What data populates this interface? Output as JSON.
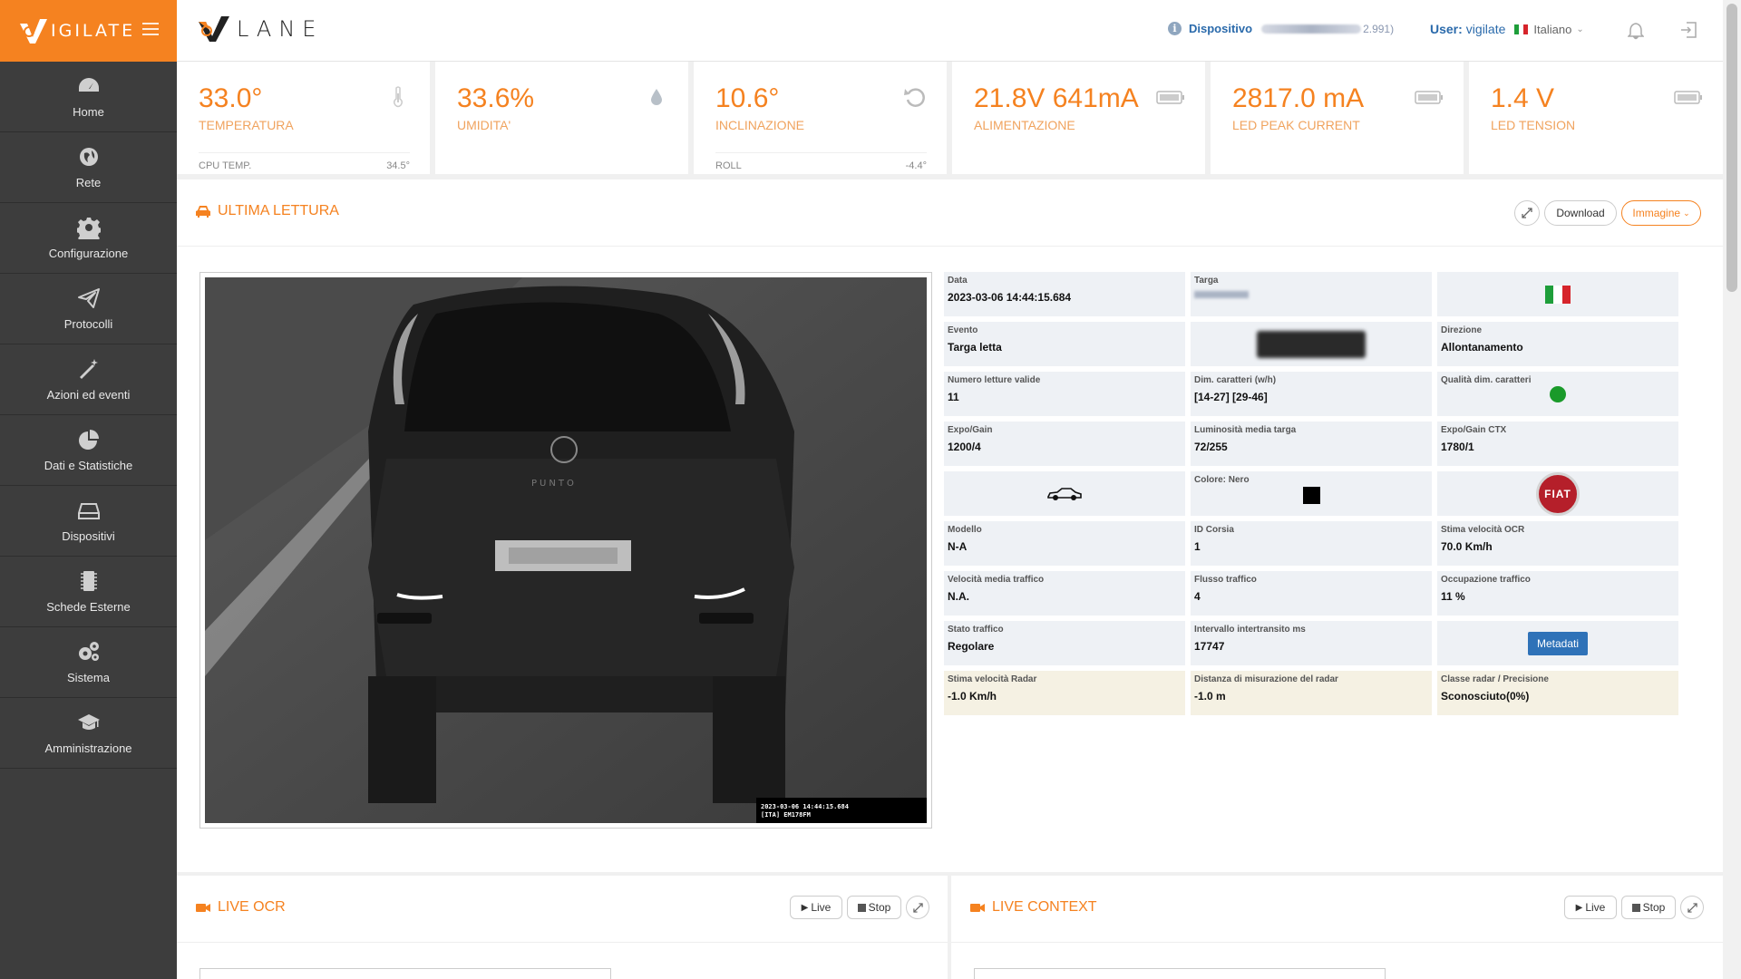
{
  "brand": {
    "name": "IGILATE"
  },
  "sidebar": {
    "items": [
      {
        "label": "Home",
        "icon": "dashboard-icon"
      },
      {
        "label": "Rete",
        "icon": "globe-icon"
      },
      {
        "label": "Configurazione",
        "icon": "gear-icon"
      },
      {
        "label": "Protocolli",
        "icon": "paper-plane-icon"
      },
      {
        "label": "Azioni ed eventi",
        "icon": "magic-wand-icon"
      },
      {
        "label": "Dati e Statistiche",
        "icon": "pie-chart-icon"
      },
      {
        "label": "Dispositivi",
        "icon": "hdd-icon"
      },
      {
        "label": "Schede Esterne",
        "icon": "chip-icon"
      },
      {
        "label": "Sistema",
        "icon": "cogs-icon"
      },
      {
        "label": "Amministrazione",
        "icon": "graduation-cap-icon"
      }
    ]
  },
  "header": {
    "logo_text": "LANE",
    "device_label": "Dispositivo",
    "device_value": "2.991)",
    "user_label": "User:",
    "user_name": "vigilate",
    "language": "Italiano"
  },
  "metrics": [
    {
      "value": "33.0°",
      "label": "TEMPERATURA",
      "icon": "thermometer-icon",
      "foot_label": "CPU TEMP.",
      "foot_value": "34.5°"
    },
    {
      "value": "33.6%",
      "label": "UMIDITA'",
      "icon": "drop-icon"
    },
    {
      "value": "10.6°",
      "label": "INCLINAZIONE",
      "icon": "rotate-icon",
      "foot_label": "ROLL",
      "foot_value": "-4.4°"
    },
    {
      "value": "21.8V 641mA",
      "label": "ALIMENTAZIONE",
      "icon": "battery-icon"
    },
    {
      "value": "2817.0 mA",
      "label": "LED PEAK CURRENT",
      "icon": "battery-icon"
    },
    {
      "value": "1.4 V",
      "label": "LED TENSION",
      "icon": "battery-icon"
    }
  ],
  "lettura": {
    "title": "ULTIMA LETTURA",
    "download_label": "Download",
    "image_select": "Immagine",
    "cam_stamp_line1": "2023-03-06  14:44:15.684",
    "cam_stamp_line2": "[ITA]  EM178FM",
    "car_badge": "PUNTO",
    "cells": {
      "data_label": "Data",
      "data_value": "2023-03-06 14:44:15.684",
      "targa_label": "Targa",
      "evento_label": "Evento",
      "evento_value": "Targa letta",
      "direzione_label": "Direzione",
      "direzione_value": "Allontanamento",
      "letture_label": "Numero letture valide",
      "letture_value": "11",
      "dim_label": "Dim. caratteri (w/h)",
      "dim_value": "[14-27] [29-46]",
      "qualita_label": "Qualità dim. caratteri",
      "expo_label": "Expo/Gain",
      "expo_value": "1200/4",
      "lum_label": "Luminosità media targa",
      "lum_value": "72/255",
      "expoctx_label": "Expo/Gain CTX",
      "expoctx_value": "1780/1",
      "colore_label": "Colore: Nero",
      "brand_logo": "FIAT",
      "modello_label": "Modello",
      "modello_value": "N-A",
      "corsia_label": "ID Corsia",
      "corsia_value": "1",
      "vel_ocr_label": "Stima velocità OCR",
      "vel_ocr_value": "70.0 Km/h",
      "vel_media_label": "Velocità media traffico",
      "vel_media_value": "N.A.",
      "flusso_label": "Flusso traffico",
      "flusso_value": "4",
      "occup_label": "Occupazione traffico",
      "occup_value": "11 %",
      "stato_label": "Stato traffico",
      "stato_value": "Regolare",
      "intervallo_label": "Intervallo intertransito ms",
      "intervallo_value": "17747",
      "metadati_label": "Metadati",
      "radar_vel_label": "Stima velocità Radar",
      "radar_vel_value": "-1.0 Km/h",
      "radar_dist_label": "Distanza di misurazione del radar",
      "radar_dist_value": "-1.0 m",
      "radar_class_label": "Classe radar / Precisione",
      "radar_class_value": "Sconosciuto(0%)"
    }
  },
  "live_ocr": {
    "title": "LIVE OCR",
    "live_label": "Live",
    "stop_label": "Stop"
  },
  "live_context": {
    "title": "LIVE CONTEXT",
    "live_label": "Live",
    "stop_label": "Stop"
  },
  "colors": {
    "accent": "#f58220",
    "sidebar": "#3d3d3d",
    "link": "#2a6aab",
    "quality_ok": "#1a9a2a",
    "radar_bg": "#f5f1e3"
  }
}
